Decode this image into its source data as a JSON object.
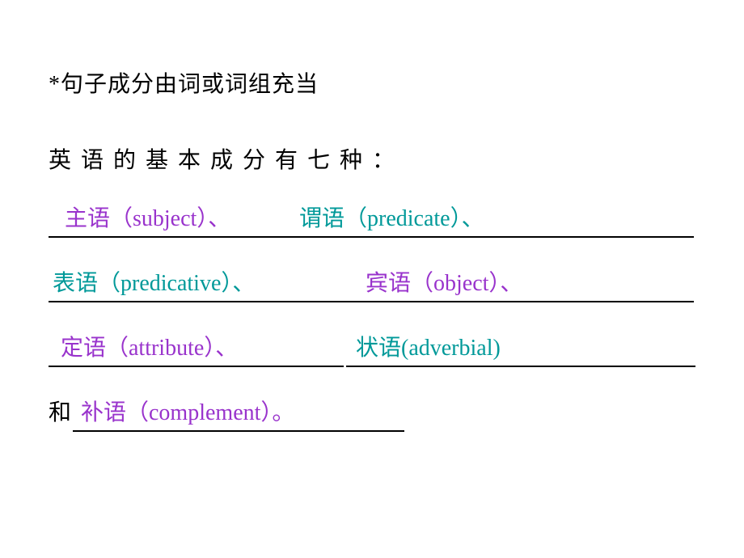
{
  "title": "*句子成分由词或词组充当",
  "intro": "英语的基本成分有七种：",
  "line1": {
    "subject": "主语（subject）、",
    "predicate": "谓语（predicate）、"
  },
  "line2": {
    "predicative": "表语（predicative）、",
    "object": "宾语（object）、"
  },
  "line3": {
    "attribute": "定语（attribute）、",
    "adverbial": "状语(adverbial)"
  },
  "line4": {
    "prefix": "和",
    "complement": "补语（complement）。"
  }
}
